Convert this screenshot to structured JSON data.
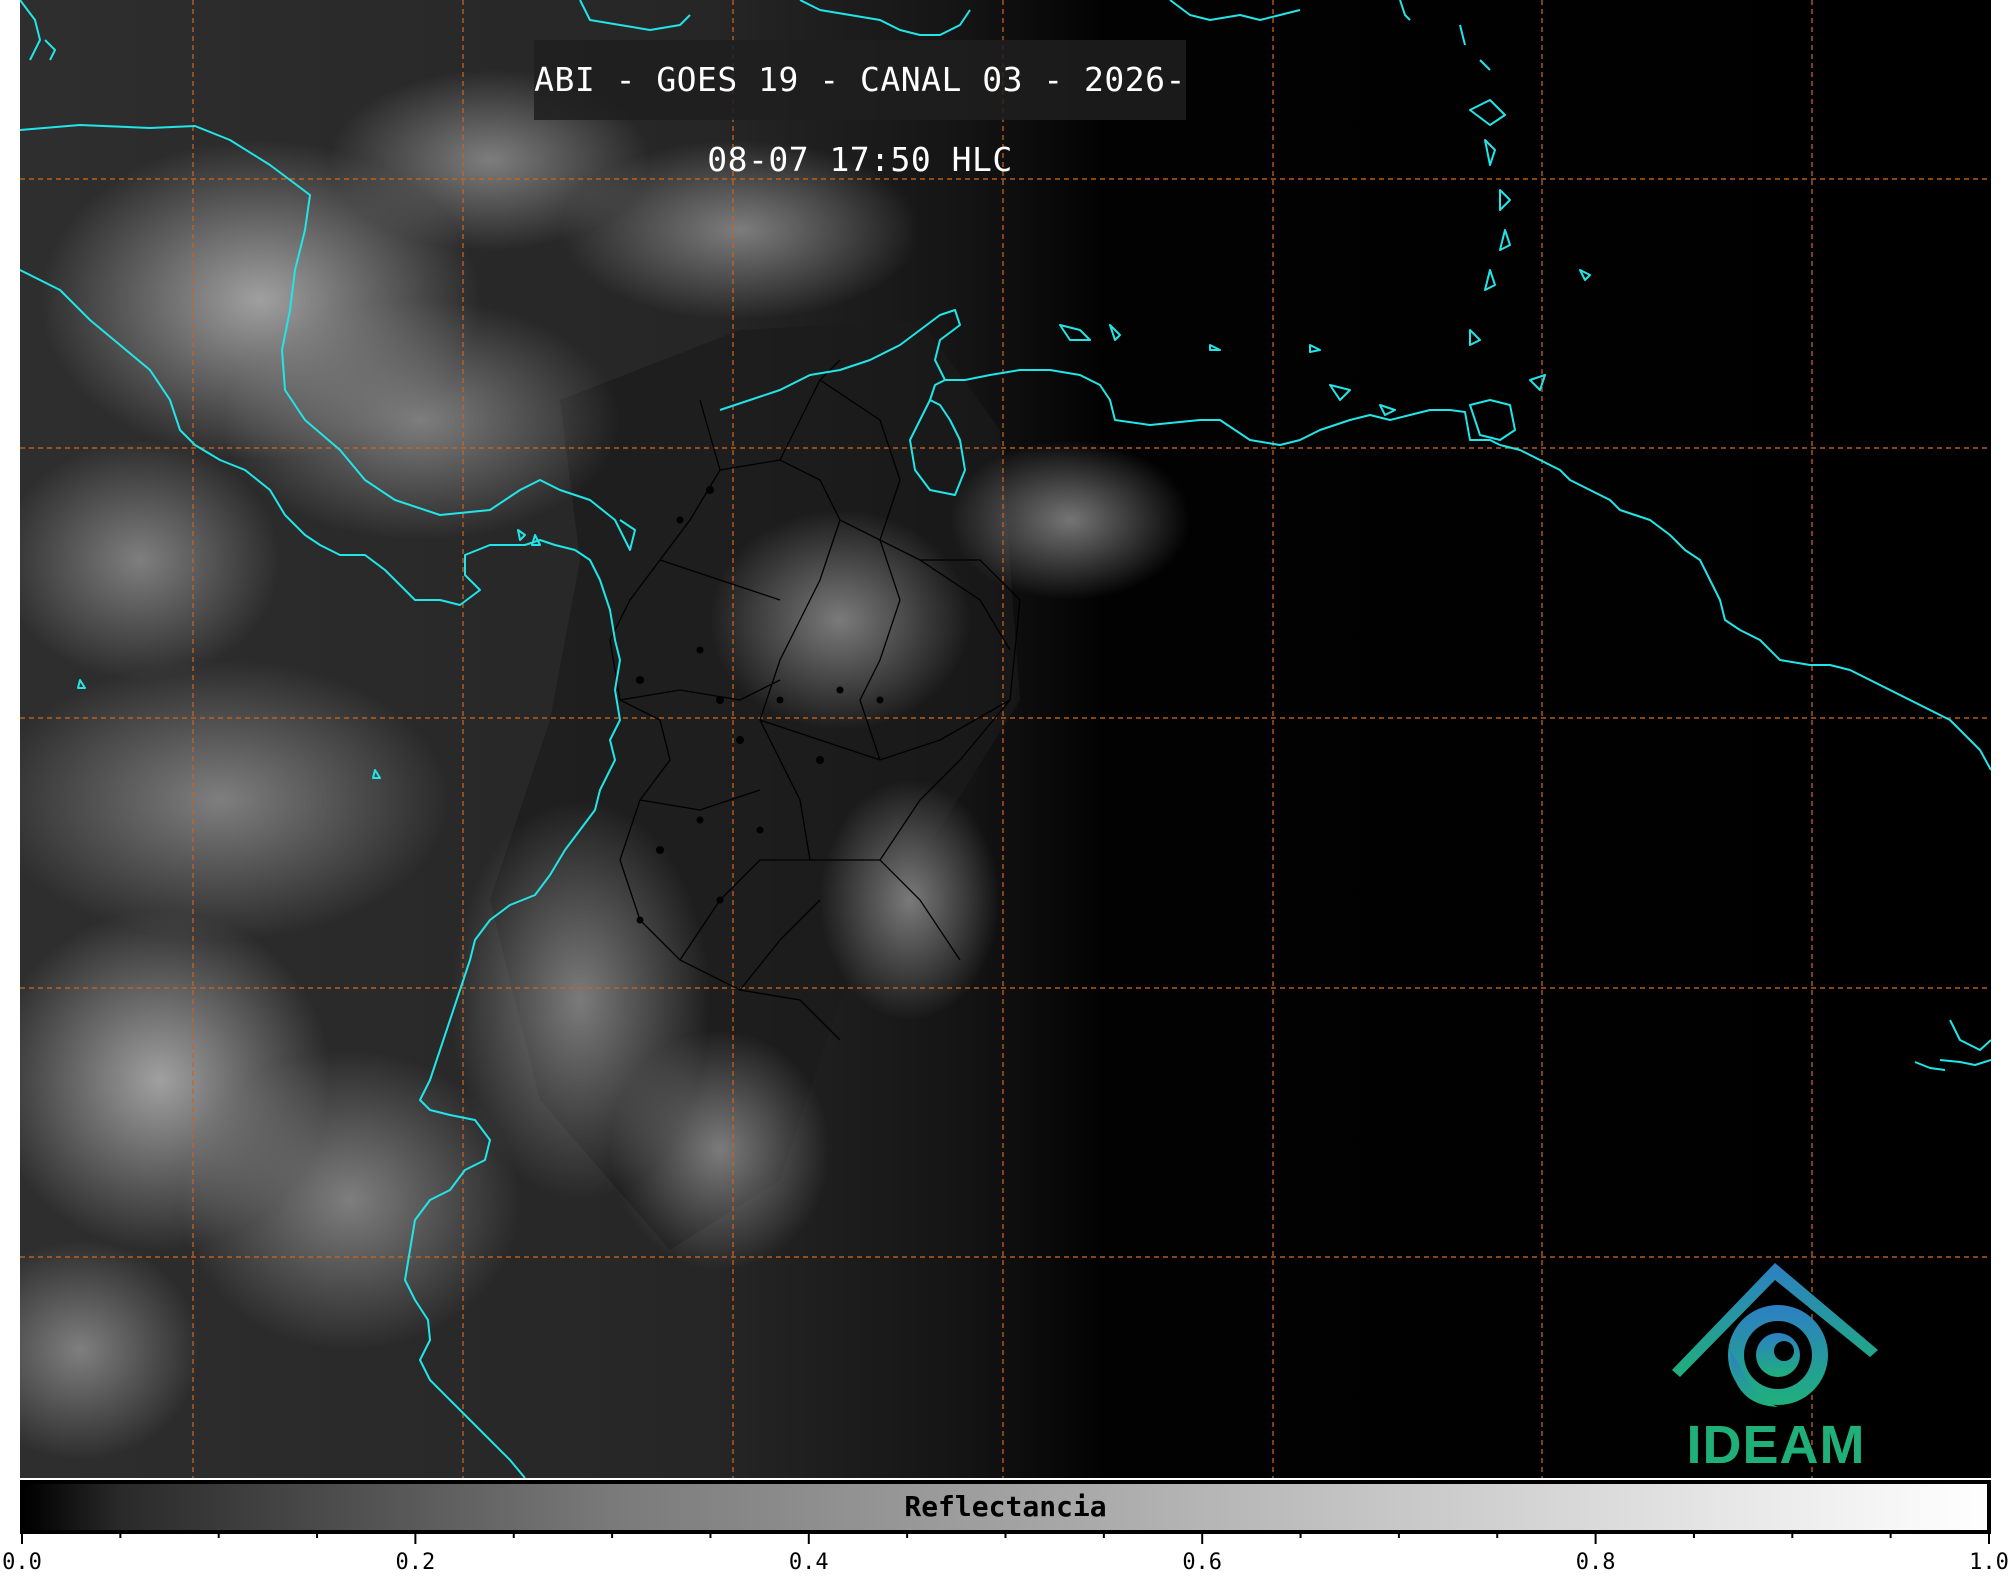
{
  "title": "ABI - GOES 19 - CANAL 03 - 2026-08-07 17:50 HLC",
  "colors": {
    "coastline": "#22e5e8",
    "grid": "#c8641e",
    "borders": "#000000",
    "logo_blue": "#2d7fc4",
    "logo_green": "#1fb07a"
  },
  "logo": {
    "text": "IDEAM"
  },
  "colorbar": {
    "label": "Reflectancia",
    "range": [
      0.0,
      1.0
    ],
    "major_ticks": [
      "0.0",
      "0.2",
      "0.4",
      "0.6",
      "0.8",
      "1.0"
    ],
    "minor_step": 0.05
  }
}
